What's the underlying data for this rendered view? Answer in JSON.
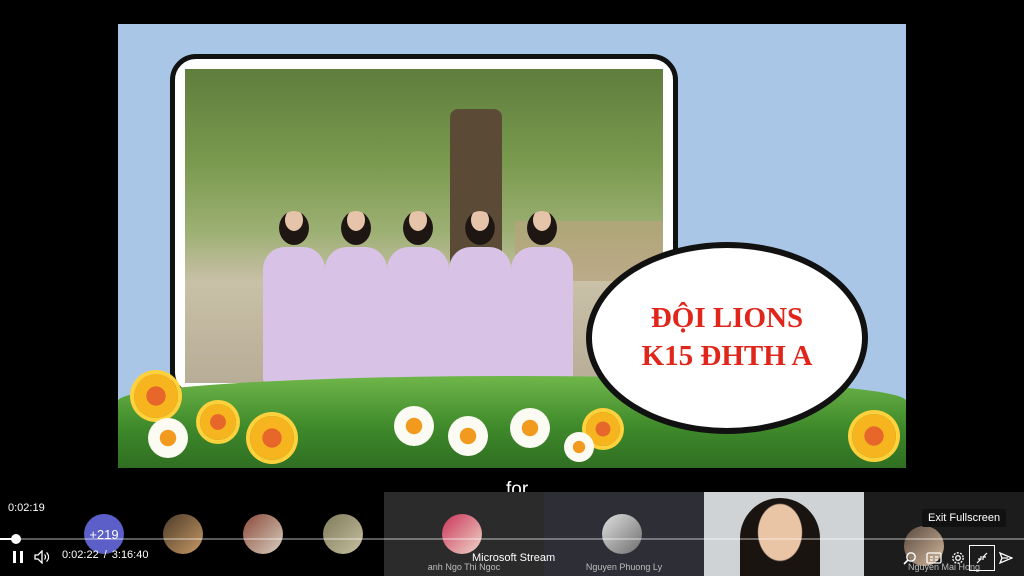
{
  "slide": {
    "title_line1": "ĐỘI LIONS",
    "title_line2": "K15 ĐHTH A"
  },
  "caption": "for",
  "hover_time": "0:02:19",
  "participants": {
    "overflow_count": "+219",
    "tiles": [
      {
        "name": "anh Ngo Thi Ngoc"
      },
      {
        "name": "Nguyen Phuong Ly"
      },
      {
        "name": ""
      },
      {
        "name": "Nguyen Mai Hong"
      }
    ]
  },
  "player": {
    "current_time": "0:02:22",
    "separator": "/",
    "duration": "3:16:40",
    "brand": "Microsoft Stream",
    "progress_fraction": 0.012,
    "tooltip": "Exit Fullscreen"
  },
  "icons": [
    "pause-icon",
    "volume-icon",
    "search-icon",
    "captions-icon",
    "settings-icon",
    "exit-fullscreen-icon",
    "share-icon"
  ],
  "colors": {
    "title_red": "#e0251b",
    "slide_sky": "#a9c6e6",
    "avatar_more": "#5b5fc7"
  }
}
